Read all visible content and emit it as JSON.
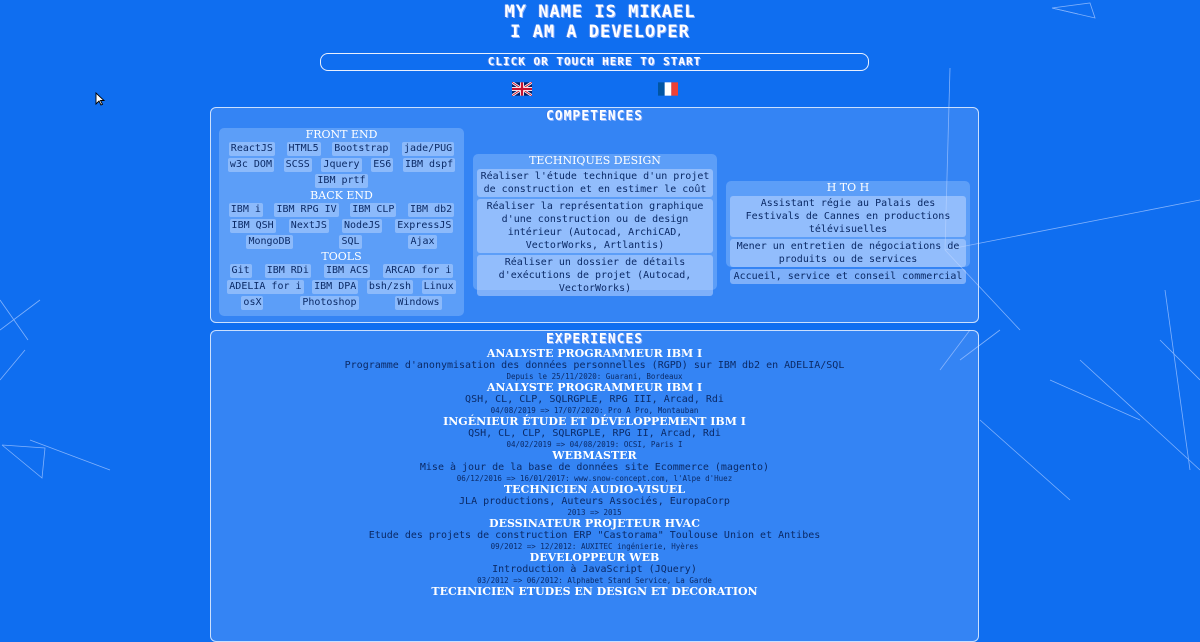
{
  "header": {
    "line1": "MY NAME IS MIKAEL",
    "line2": "I AM A DEVELOPER",
    "start_label": "CLICK OR TOUCH HERE TO START"
  },
  "competences": {
    "title": "COMPETENCES",
    "front_end": {
      "title": "FRONT END",
      "items": [
        "ReactJS",
        "HTML5",
        "Bootstrap",
        "jade/PUG",
        "w3c DOM",
        "SCSS",
        "Jquery",
        "ES6",
        "IBM dspf",
        "IBM prtf"
      ]
    },
    "back_end": {
      "title": "BACK END",
      "items": [
        "IBM i",
        "IBM RPG IV",
        "IBM CLP",
        "IBM db2",
        "IBM QSH",
        "NextJS",
        "NodeJS",
        "ExpressJS",
        "MongoDB",
        "SQL",
        "Ajax"
      ]
    },
    "tools": {
      "title": "TOOLS",
      "items": [
        "Git",
        "IBM RDi",
        "IBM ACS",
        "ARCAD for i",
        "ADELIA for i",
        "IBM DPA",
        "bsh/zsh",
        "Linux",
        "osX",
        "Photoshop",
        "Windows"
      ]
    },
    "techniques": {
      "title": "TECHNIQUES DESIGN",
      "items": [
        "Réaliser l'étude technique d'un projet de construction et en estimer le coût",
        "Réaliser la représentation graphique d'une construction ou de design intérieur (Autocad, ArchiCAD, VectorWorks, Artlantis)",
        "Réaliser un dossier de détails d'exécutions de projet (Autocad, VectorWorks)"
      ]
    },
    "hth": {
      "title": "H TO H",
      "items": [
        "Assistant régie au Palais des Festivals de Cannes en productions télévisuelles",
        "Mener un entretien de négociations de produits ou de services",
        "Accueil, service et conseil commercial"
      ]
    }
  },
  "experiences": {
    "title": "EXPERIENCES",
    "jobs": [
      {
        "title": "ANALYSTE PROGRAMMEUR IBM I",
        "desc": "Programme d'anonymisation des données personnelles (RGPD) sur IBM db2 en ADELIA/SQL",
        "meta": "Depuis le 25/11/2020: Guarani, Bordeaux"
      },
      {
        "title": "ANALYSTE PROGRAMMEUR IBM I",
        "desc": "QSH, CL, CLP, SQLRGPLE, RPG III, Arcad, Rdi",
        "meta": "04/08/2019 => 17/07/2020: Pro A Pro, Montauban"
      },
      {
        "title": "INGÉNIEUR ÉTUDE ET DÉVELOPPEMENT IBM I",
        "desc": "QSH, CL, CLP, SQLRGPLE, RPG II, Arcad, Rdi",
        "meta": "04/02/2019 => 04/08/2019: OCSI, Paris I"
      },
      {
        "title": "WEBMASTER",
        "desc": "Mise à jour de la base de données site Ecommerce (magento)",
        "meta": "06/12/2016 => 16/01/2017: www.snow-concept.com, l'Alpe d'Huez"
      },
      {
        "title": "TECHNICIEN AUDIO-VISUEL",
        "desc": "JLA productions, Auteurs Associés, EuropaCorp",
        "meta": "2013 => 2015"
      },
      {
        "title": "DESSINATEUR PROJETEUR HVAC",
        "desc": "Etude des projets de construction ERP \"Castorama\" Toulouse Union et Antibes",
        "meta": "09/2012 => 12/2012: AUXITEC ingénierie, Hyères"
      },
      {
        "title": "DEVELOPPEUR WEB",
        "desc": "Introduction à JavaScript (JQuery)",
        "meta": "03/2012 => 06/2012: Alphabet Stand Service, La Garde"
      },
      {
        "title": "TECHNICIEN ETUDES EN DESIGN ET DECORATION",
        "desc": "",
        "meta": ""
      }
    ]
  },
  "colors": {
    "background": "#0f6ef0",
    "text_dark": "#0b2a66"
  }
}
